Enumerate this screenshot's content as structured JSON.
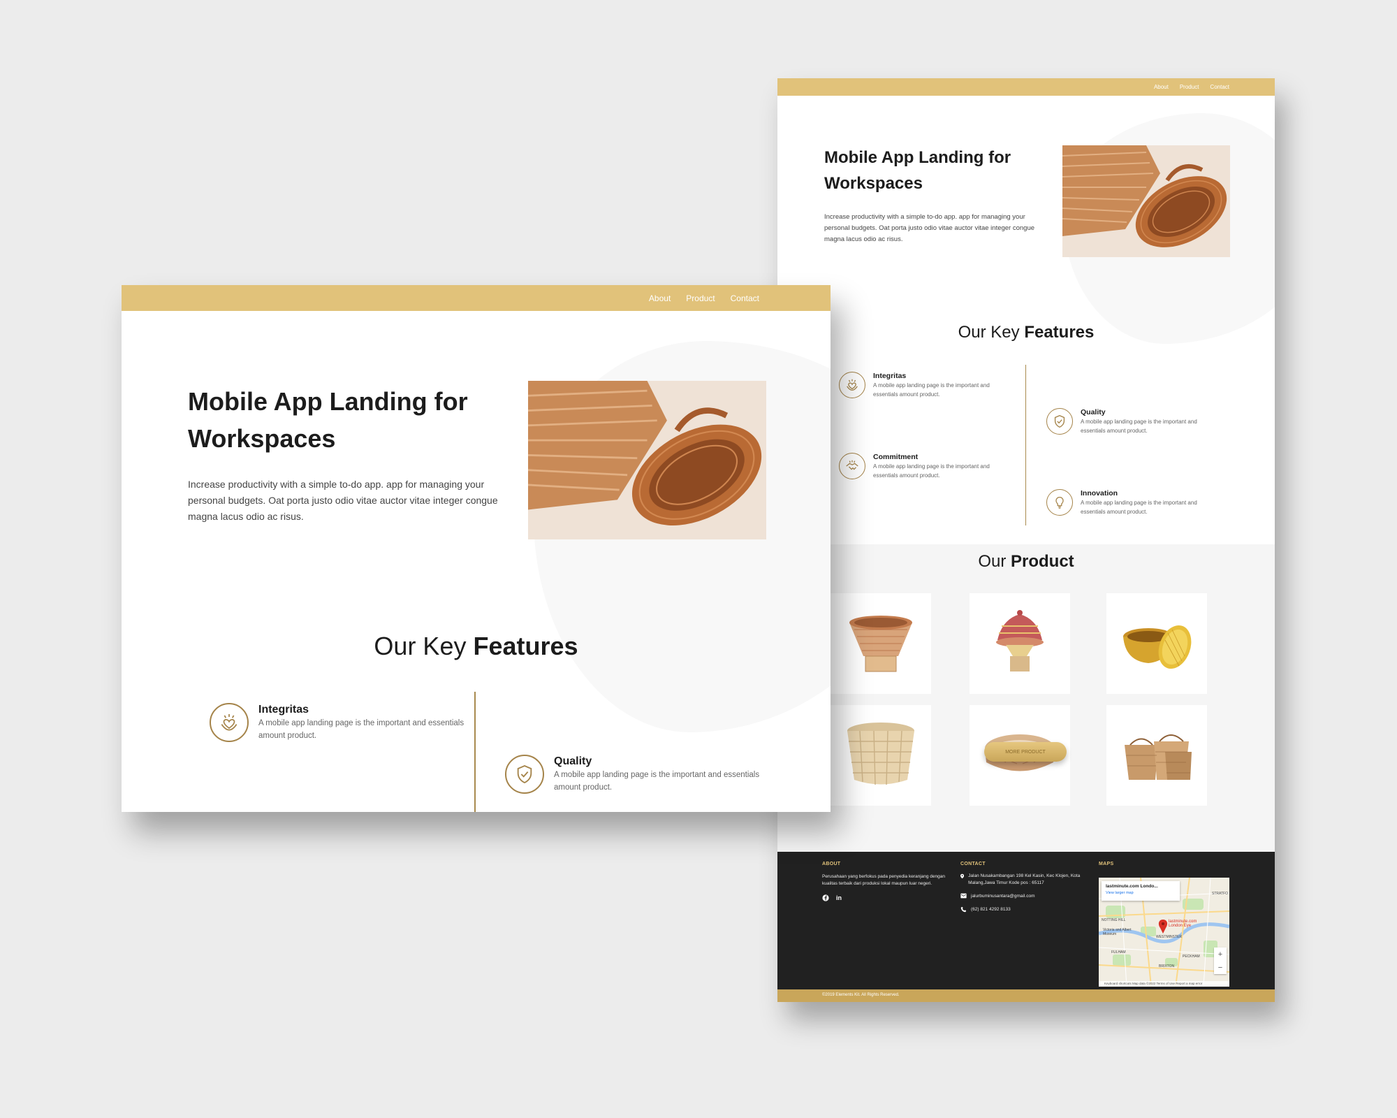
{
  "nav": {
    "about": "About",
    "product": "Product",
    "contact": "Contact"
  },
  "hero": {
    "title": "Mobile App Landing for Workspaces",
    "description": "Increase productivity with a simple to-do app. app for managing your personal budgets. Oat porta justo odio vitae auctor vitae integer congue magna lacus odio ac risus."
  },
  "features": {
    "title_prefix": "Our Key ",
    "title_bold": "Features",
    "items": [
      {
        "name": "Integritas",
        "desc": "A mobile app landing page is the important and essentials amount product.",
        "icon": "heart-hands-icon"
      },
      {
        "name": "Quality",
        "desc": "A mobile app landing page is the important and essentials amount product.",
        "icon": "shield-check-icon"
      },
      {
        "name": "Commitment",
        "desc": "A mobile app landing page is the important and essentials amount product.",
        "icon": "handshake-icon"
      },
      {
        "name": "Innovation",
        "desc": "A mobile app landing page is the important and essentials amount product.",
        "icon": "lightbulb-icon"
      }
    ]
  },
  "products": {
    "title_prefix": "Our ",
    "title_bold": "Product",
    "more_button": "MORE PRODUCT"
  },
  "footer": {
    "about_heading": "ABOUT",
    "about_text": "Perusahaan yang berfokus pada penyedia keranjang dengan kualitas terbaik dari produksi lokal maupun luar negeri.",
    "contact_heading": "CONTACT",
    "address": "Jalan Nusakambangan 198 Kel Kasin, Kec Klojen, Kota Malang,Jawa Timur Kode pos : 65117",
    "email": "jalurbuminusantara@gmail.com",
    "phone": "(62) 821 4292 8133",
    "maps_heading": "MAPS",
    "map_card_title": "lastminute.com Londo...",
    "map_card_link": "View larger map",
    "map_pin_label": "lastminute.com London Eye",
    "map_labels": [
      "NOTTING HILL",
      "Victoria and Albert Museum",
      "WESTMINSTER",
      "FULHAM",
      "BRIXTON",
      "PECKHAM",
      "STRATFO"
    ],
    "map_footer": "Keyboard shortcuts   Map data ©2022   Terms of Use   Report a map error",
    "copyright": "©2019 Elements Kit. All Rights Reserved."
  },
  "colors": {
    "accent": "#e1c27a",
    "accent_dark": "#a5844a",
    "footer_bg": "#212121",
    "heading": "#1c1c1c"
  }
}
